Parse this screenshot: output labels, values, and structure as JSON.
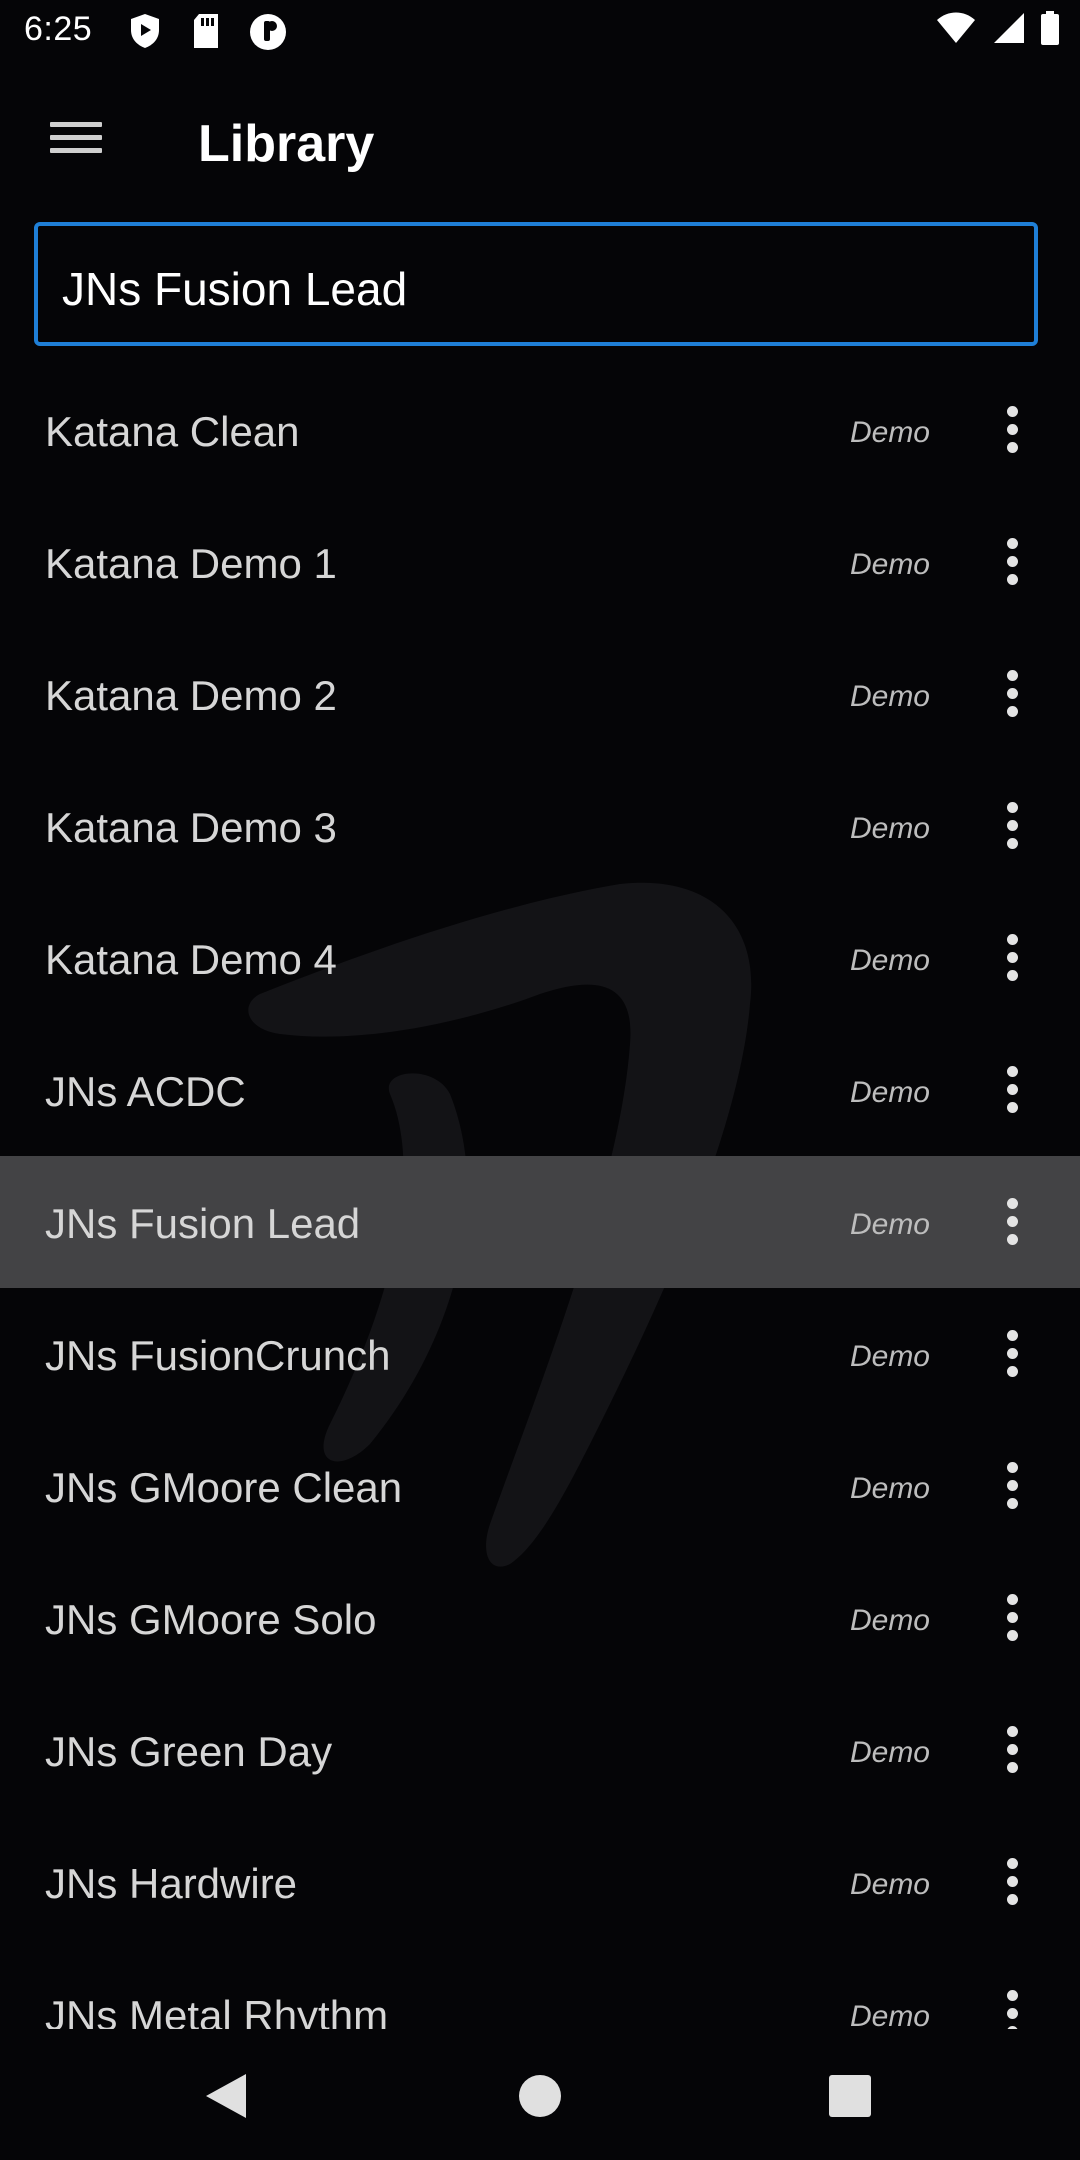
{
  "status": {
    "time": "6:25"
  },
  "appbar": {
    "title": "Library"
  },
  "search": {
    "value": "JNs Fusion Lead"
  },
  "library": {
    "items": [
      {
        "name": "Katana Clean",
        "tag": "Demo"
      },
      {
        "name": "Katana Demo 1",
        "tag": "Demo"
      },
      {
        "name": "Katana Demo 2",
        "tag": "Demo"
      },
      {
        "name": "Katana Demo 3",
        "tag": "Demo"
      },
      {
        "name": "Katana Demo 4",
        "tag": "Demo"
      },
      {
        "name": "JNs ACDC",
        "tag": "Demo"
      },
      {
        "name": "JNs Fusion Lead",
        "tag": "Demo"
      },
      {
        "name": "JNs FusionCrunch",
        "tag": "Demo"
      },
      {
        "name": "JNs GMoore Clean",
        "tag": "Demo"
      },
      {
        "name": "JNs GMoore Solo",
        "tag": "Demo"
      },
      {
        "name": "JNs Green Day",
        "tag": "Demo"
      },
      {
        "name": "JNs Hardwire",
        "tag": "Demo"
      },
      {
        "name": "JNs Metal Rhythm",
        "tag": "Demo"
      }
    ],
    "selected_index": 6
  },
  "icons": {
    "menu": "hamburger-menu-icon",
    "more": "more-vert-icon",
    "back": "nav-back-icon",
    "home": "nav-home-icon",
    "recents": "nav-recents-icon"
  },
  "colors": {
    "accent": "#1f7fd6",
    "background": "#050507",
    "selected_row": "#434345"
  }
}
